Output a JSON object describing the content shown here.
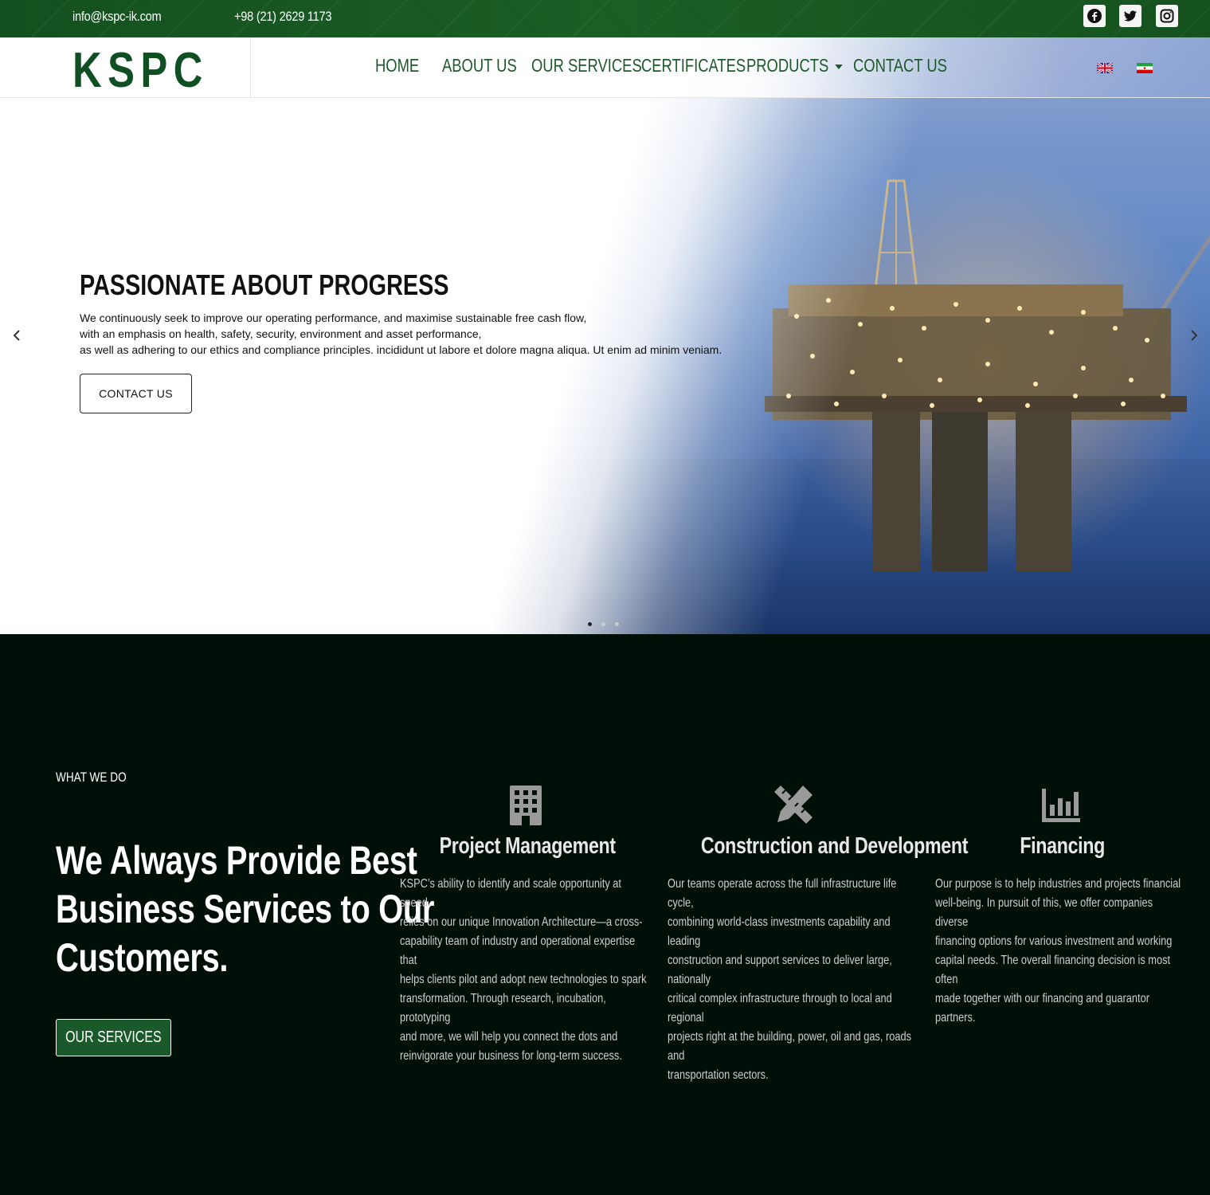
{
  "topbar": {
    "email": "info@kspc-ik.com",
    "phone": "+98 (21) 2629 1173",
    "social": [
      "facebook-icon",
      "twitter-icon",
      "instagram-icon"
    ]
  },
  "header": {
    "logo": "KSPC",
    "nav": [
      {
        "label": "HOME"
      },
      {
        "label": "ABOUT US"
      },
      {
        "label": "OUR SERVICES"
      },
      {
        "label": "CERTIFICATES"
      },
      {
        "label": "PRODUCTS"
      },
      {
        "label": "CONTACT US"
      }
    ],
    "languages": [
      "english-flag-icon",
      "iran-flag-icon"
    ]
  },
  "hero": {
    "title": "PASSIONATE ABOUT PROGRESS",
    "lines": [
      "We continuously seek to improve our operating performance, and maximise sustainable free cash flow,",
      "with an emphasis on health, safety, security, environment and asset performance,",
      "as well as adhering to our ethics and compliance principles. incididunt ut labore et dolore magna aliqua. Ut enim ad minim veniam."
    ],
    "button": "CONTACT US",
    "slides": 3,
    "active_slide": 1
  },
  "services": {
    "eyebrow": "WHAT WE DO",
    "heading": [
      "We Always Provide Best",
      "Business Services to Our",
      "Customers."
    ],
    "button": "OUR SERVICES",
    "columns": [
      {
        "icon": "building-icon",
        "title": "Project Management",
        "lines": [
          "KSPC’s ability to identify and scale opportunity at speed",
          "relies on our unique Innovation Architecture—a cross-",
          "capability team of industry and operational expertise that",
          "helps clients pilot and adopt new technologies to spark",
          "transformation. Through research, incubation, prototyping",
          "and more, we will help you connect the dots and",
          "reinvigorate your business for long-term success."
        ]
      },
      {
        "icon": "pencil-ruler-icon",
        "title": "Construction and Development",
        "lines": [
          "Our teams operate across the full infrastructure life cycle,",
          "combining world-class investments capability and leading",
          "construction and support services to deliver large, nationally",
          "critical complex infrastructure through to local and regional",
          "projects right at the building, power, oil and gas, roads and",
          "transportation sectors."
        ]
      },
      {
        "icon": "chart-bar-icon",
        "title": "Financing",
        "lines": [
          "Our purpose is to help industries and projects financial",
          "well-being. In pursuit of this, we offer companies diverse",
          "financing options for various investment and working",
          "capital needs. The overall financing decision is most often",
          "made together with our financing and guarantor partners."
        ]
      }
    ]
  },
  "colors": {
    "brand_green": "#1a5a2a",
    "topbar_green": "#1b5e26",
    "dark_bg": "#000f07"
  }
}
